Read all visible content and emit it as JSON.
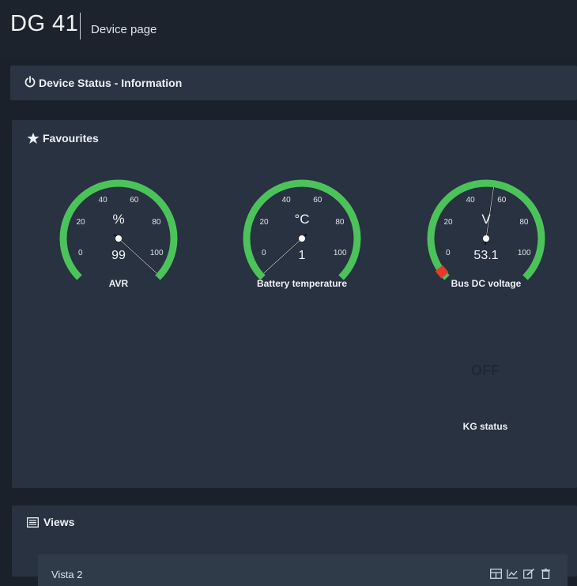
{
  "header": {
    "device": "DG 41",
    "page": "Device page"
  },
  "status_bar": {
    "label": "Device Status - Information",
    "icon": "power-icon"
  },
  "favourites": {
    "label": "Favourites",
    "icon": "star-icon",
    "gauges": [
      {
        "name": "AVR",
        "unit": "%",
        "value": "99",
        "ticks": [
          "0",
          "20",
          "40",
          "60",
          "80",
          "100"
        ],
        "min": 0,
        "max": 100,
        "reading": 99
      },
      {
        "name": "Battery temperature",
        "unit": "°C",
        "value": "1",
        "ticks": [
          "0",
          "20",
          "40",
          "60",
          "80",
          "100"
        ],
        "min": 0,
        "max": 100,
        "reading": 1
      },
      {
        "name": "Bus DC voltage",
        "unit": "V",
        "value": "53.1",
        "ticks": [
          "0",
          "20",
          "40",
          "60",
          "80",
          "100"
        ],
        "min": 0,
        "max": 100,
        "reading": 53.1
      }
    ],
    "kg_status": {
      "value": "OFF",
      "label": "KG status"
    }
  },
  "views": {
    "label": "Views",
    "icon": "list-icon",
    "items": [
      {
        "name": "Vista 2"
      }
    ],
    "tool_icons": [
      "layout-icon",
      "chart-icon",
      "edit-icon",
      "delete-icon"
    ]
  },
  "colors": {
    "arc": "#4cc35a",
    "alarm": "#e8392d",
    "background": "#1b212b",
    "panel": "#283240"
  }
}
